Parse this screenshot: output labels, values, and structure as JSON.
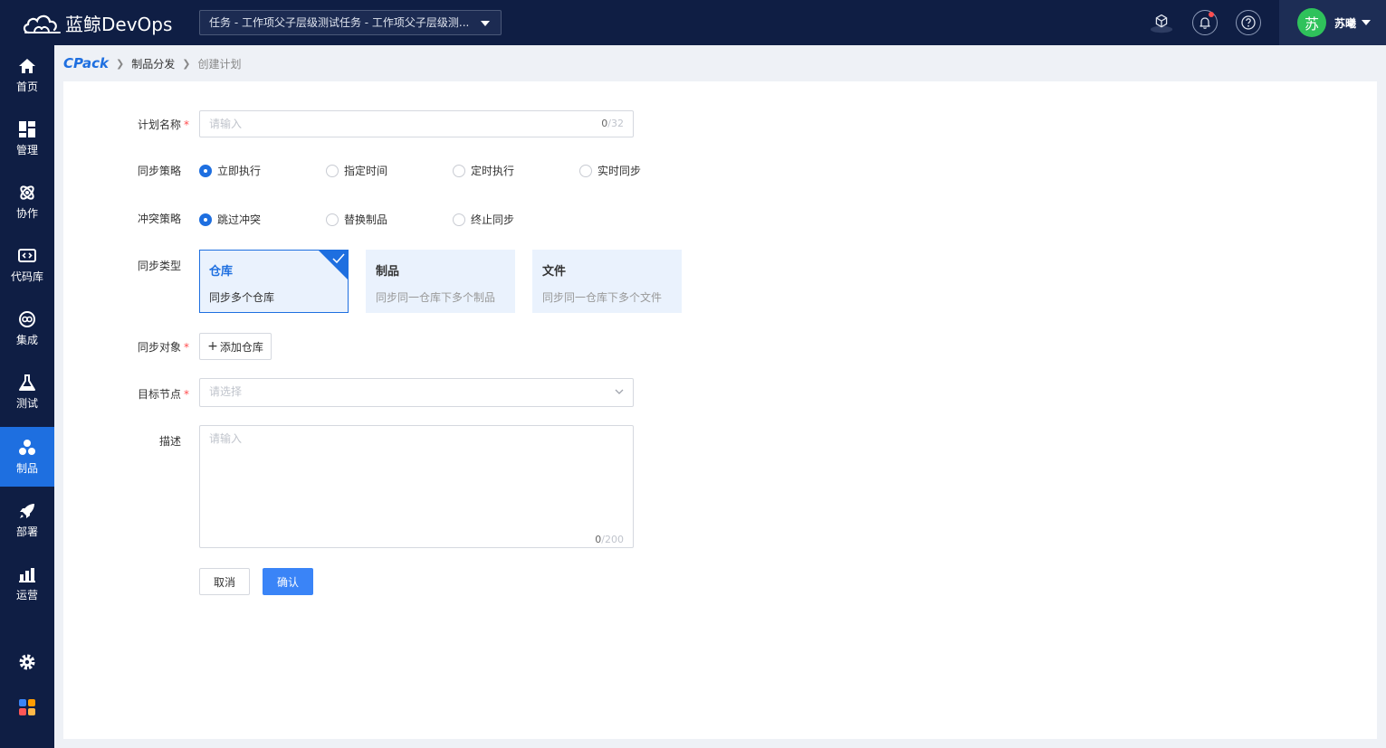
{
  "header": {
    "logo_text": "蓝鲸DevOps",
    "project": "任务 - 工作项父子层级测试任务 - 工作项父子层级测...",
    "user_avatar": "苏",
    "user_name": "苏曦"
  },
  "sidebar": {
    "items": [
      {
        "label": "首页",
        "icon": "home-icon"
      },
      {
        "label": "管理",
        "icon": "dashboard-icon"
      },
      {
        "label": "协作",
        "icon": "collaboration-icon"
      },
      {
        "label": "代码库",
        "icon": "code-icon"
      },
      {
        "label": "集成",
        "icon": "integration-icon"
      },
      {
        "label": "测试",
        "icon": "flask-icon"
      },
      {
        "label": "制品",
        "icon": "artifact-icon"
      },
      {
        "label": "部署",
        "icon": "rocket-icon"
      },
      {
        "label": "运营",
        "icon": "chart-icon"
      }
    ],
    "active": "制品"
  },
  "breadcrumb": {
    "logo": "CPack",
    "link": "制品分发",
    "current": "创建计划"
  },
  "form": {
    "plan_name": {
      "label": "计划名称",
      "placeholder": "请输入",
      "count": "0",
      "max": "/32"
    },
    "sync_strategy": {
      "label": "同步策略",
      "options": [
        "立即执行",
        "指定时间",
        "定时执行",
        "实时同步"
      ],
      "selected": "立即执行"
    },
    "conflict_strategy": {
      "label": "冲突策略",
      "options": [
        "跳过冲突",
        "替换制品",
        "终止同步"
      ],
      "selected": "跳过冲突"
    },
    "sync_type": {
      "label": "同步类型",
      "cards": [
        {
          "title": "仓库",
          "desc": "同步多个仓库"
        },
        {
          "title": "制品",
          "desc": "同步同一仓库下多个制品"
        },
        {
          "title": "文件",
          "desc": "同步同一仓库下多个文件"
        }
      ],
      "selected": "仓库"
    },
    "sync_target": {
      "label": "同步对象",
      "add_button": "添加仓库"
    },
    "target_node": {
      "label": "目标节点",
      "placeholder": "请选择"
    },
    "description": {
      "label": "描述",
      "placeholder": "请输入",
      "count": "0",
      "max": "/200"
    },
    "cancel_label": "取消",
    "confirm_label": "确认"
  },
  "colors": {
    "primary": "#1e6fe0",
    "header_bg": "#0f1e44",
    "required": "#ff4d4f"
  }
}
